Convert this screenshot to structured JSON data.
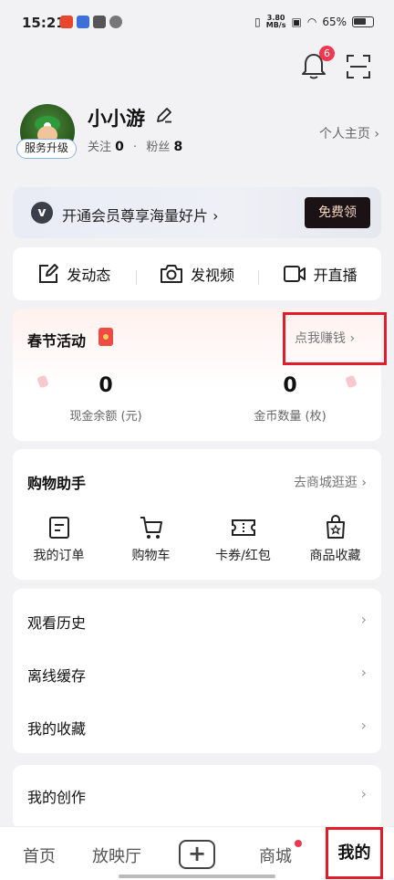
{
  "status_bar": {
    "time": "15:21",
    "speed_value": "3.80",
    "speed_unit": "MB/s",
    "battery": "65%"
  },
  "header": {
    "notification_count": "6"
  },
  "profile": {
    "username": "小小游",
    "service_badge": "服务升级",
    "following_label": "关注",
    "following_count": "0",
    "separator": "·",
    "fans_label": "粉丝",
    "fans_count": "8",
    "homepage_link": "个人主页 ›"
  },
  "vip_banner": {
    "logo": "v",
    "text": "开通会员尊享海量好片 ›",
    "button": "免费领"
  },
  "actions": [
    {
      "label": "发动态",
      "icon": "edit-post-icon"
    },
    {
      "label": "发视频",
      "icon": "camera-icon"
    },
    {
      "label": "开直播",
      "icon": "live-video-icon"
    }
  ],
  "festival": {
    "title": "春节活动",
    "earn_link": "点我赚钱 ›",
    "stats": [
      {
        "value": "0",
        "label": "现金余额 (元)"
      },
      {
        "value": "0",
        "label": "金币数量 (枚)"
      }
    ]
  },
  "shopping": {
    "title": "购物助手",
    "link": "去商城逛逛 ›",
    "items": [
      {
        "label": "我的订单",
        "icon": "order-icon"
      },
      {
        "label": "购物车",
        "icon": "cart-icon"
      },
      {
        "label": "卡券/红包",
        "icon": "coupon-icon"
      },
      {
        "label": "商品收藏",
        "icon": "favorite-goods-icon"
      }
    ]
  },
  "list": [
    {
      "label": "观看历史"
    },
    {
      "label": "离线缓存"
    },
    {
      "label": "我的收藏"
    }
  ],
  "creation": {
    "label": "我的创作"
  },
  "chevron": "›",
  "bottom_nav": {
    "home": "首页",
    "theater": "放映厅",
    "plus": "+",
    "mall": "商城",
    "me": "我的"
  },
  "colors": {
    "accent_red": "#e01d2a",
    "badge_red": "#f0384f"
  }
}
